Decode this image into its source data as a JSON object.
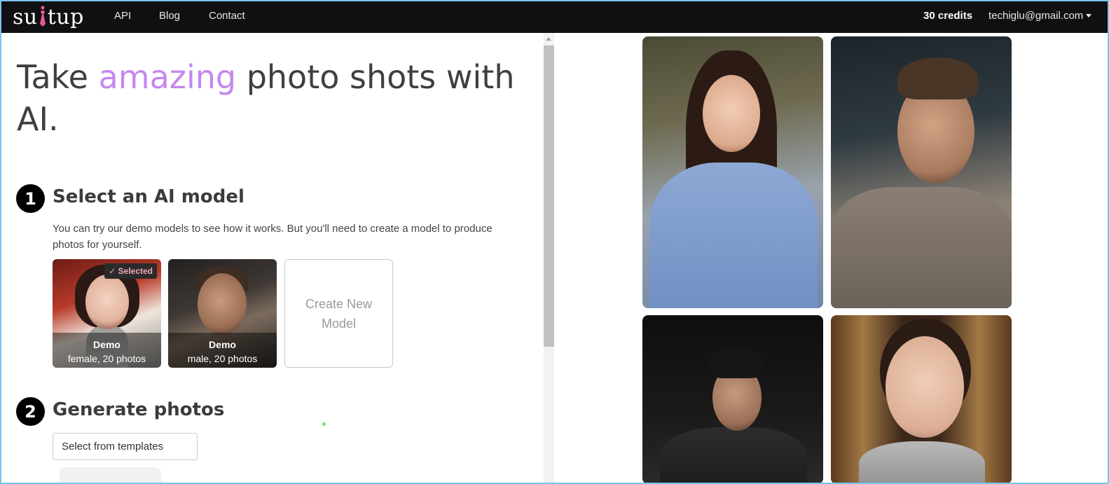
{
  "brand": {
    "logo_left": "su",
    "logo_right": "tup"
  },
  "nav": {
    "links": [
      {
        "label": "API"
      },
      {
        "label": "Blog"
      },
      {
        "label": "Contact"
      }
    ],
    "credits": "30 credits",
    "account_email": "techiglu@gmail.com"
  },
  "hero": {
    "title_before": "Take ",
    "title_accent": "amazing",
    "title_after": " photo shots with AI."
  },
  "step1": {
    "number": "1",
    "title": "Select an AI model",
    "description": "You can try our demo models to see how it works. But you'll need to create a model to produce photos for yourself.",
    "models": [
      {
        "name": "Demo",
        "subtitle": "female, 20 photos",
        "selected_label": "✓ Selected"
      },
      {
        "name": "Demo",
        "subtitle": "male, 20 photos"
      }
    ],
    "create_label": "Create New Model"
  },
  "step2": {
    "number": "2",
    "title": "Generate photos",
    "template_select": "Select from templates"
  },
  "colors": {
    "accent": "#c587ef",
    "navbar_bg": "#101012",
    "selected_badge_text": "#f1a7b3"
  }
}
